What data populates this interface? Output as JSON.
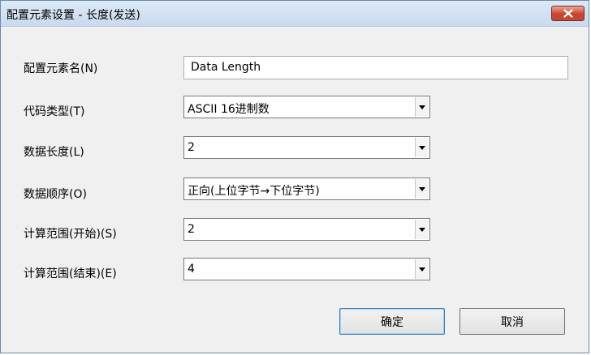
{
  "window": {
    "title": "配置元素设置 - 长度(发送)"
  },
  "fields": {
    "name": {
      "label": "配置元素名(N)",
      "value": "Data Length"
    },
    "code_type": {
      "label": "代码类型(T)",
      "value": "ASCII 16进制数"
    },
    "data_length": {
      "label": "数据长度(L)",
      "value": "2"
    },
    "data_order": {
      "label": "数据顺序(O)",
      "value": "正向(上位字节→下位字节)"
    },
    "range_start": {
      "label": "计算范围(开始)(S)",
      "value": "2"
    },
    "range_end": {
      "label": "计算范围(结束)(E)",
      "value": "4"
    }
  },
  "buttons": {
    "ok": "确定",
    "cancel": "取消"
  }
}
